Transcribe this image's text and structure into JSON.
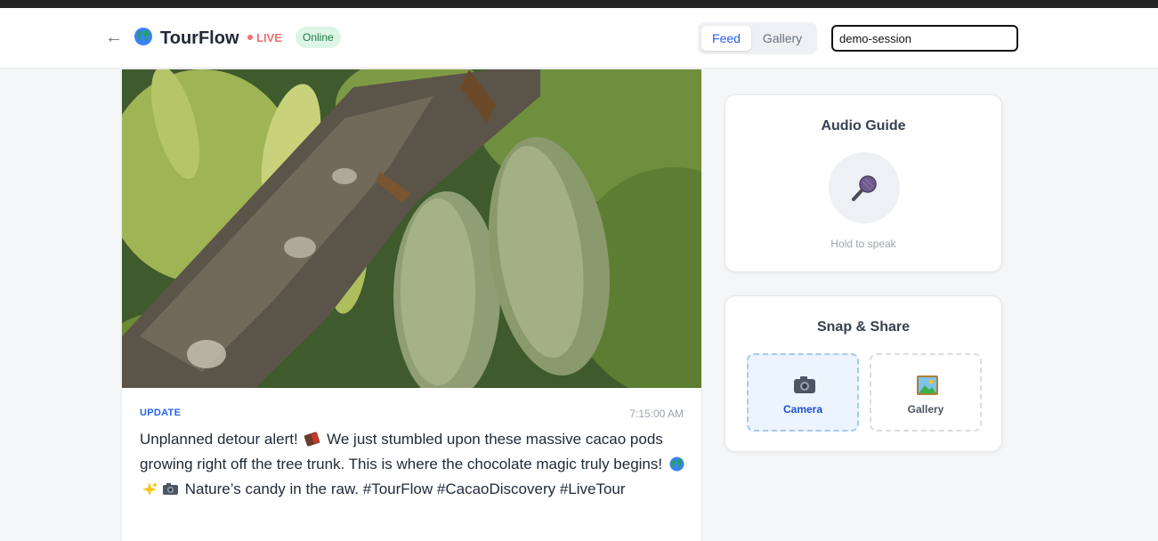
{
  "header": {
    "back_icon": "←",
    "app_name": "TourFlow",
    "live_label": "LIVE",
    "status_badge": "Online",
    "tabs": [
      {
        "label": "Feed",
        "active": true
      },
      {
        "label": "Gallery",
        "active": false
      }
    ],
    "session_value": "demo-session"
  },
  "feed": {
    "post": {
      "type_label": "UPDATE",
      "timestamp": "7:15:00 AM",
      "text_parts": [
        "Unplanned detour alert! ",
        " We just stumbled upon these massive cacao pods growing right off the tree trunk. This is where the chocolate magic truly begins! ",
        " Nature’s candy in the raw. #TourFlow #CacaoDiscovery #LiveTour"
      ],
      "icons": [
        "chocolate-bar-icon",
        "globe-icon",
        "sparkles-icon",
        "camera-icon"
      ]
    }
  },
  "audio_guide": {
    "title": "Audio Guide",
    "hint": "Hold to speak",
    "icon": "microphone-icon"
  },
  "snap_share": {
    "title": "Snap & Share",
    "options": [
      {
        "label": "Camera",
        "icon": "camera-icon",
        "selected": true
      },
      {
        "label": "Gallery",
        "icon": "picture-icon",
        "selected": false
      }
    ]
  },
  "colors": {
    "accent": "#2563eb",
    "live": "#f0716f",
    "online_bg": "#dcf5e4",
    "online_text": "#1f7a45"
  }
}
